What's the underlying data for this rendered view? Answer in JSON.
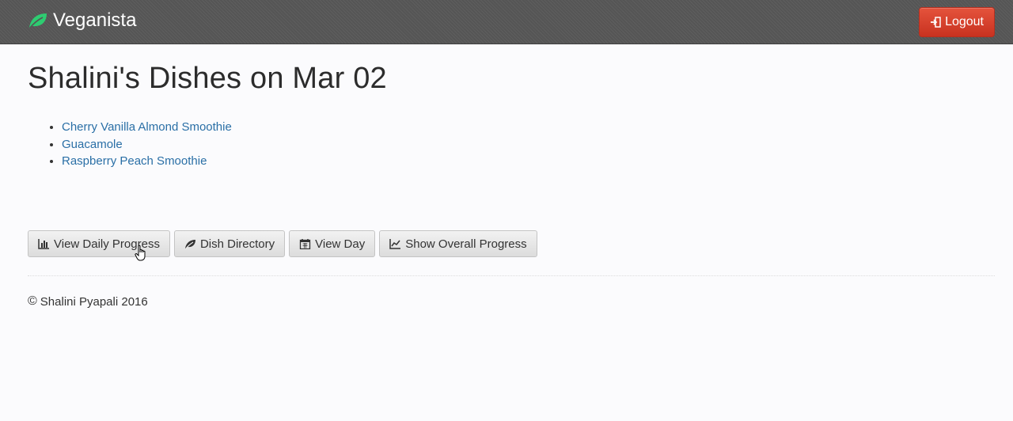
{
  "navbar": {
    "brand": "Veganista",
    "logout_label": "Logout"
  },
  "page": {
    "title": "Shalini's Dishes on Mar 02",
    "dishes": [
      "Cherry Vanilla Almond Smoothie",
      "Guacamole",
      "Raspberry Peach Smoothie"
    ]
  },
  "actions": {
    "daily_progress": "View Daily Progress",
    "dish_directory": "Dish Directory",
    "view_day": "View Day",
    "overall_progress": "Show Overall Progress"
  },
  "footer": {
    "copyright_symbol": "©",
    "text": "Shalini Pyapali 2016"
  },
  "colors": {
    "navbar": "#555555",
    "brand_leaf": "#2ecc71",
    "logout": "#d9412c",
    "link": "#2a6fa6"
  },
  "icons": {
    "brand": "leaf-icon",
    "logout": "logout-icon",
    "daily_progress": "bar-chart-icon",
    "dish_directory": "leaf-icon",
    "view_day": "calendar-icon",
    "overall_progress": "line-chart-icon"
  }
}
